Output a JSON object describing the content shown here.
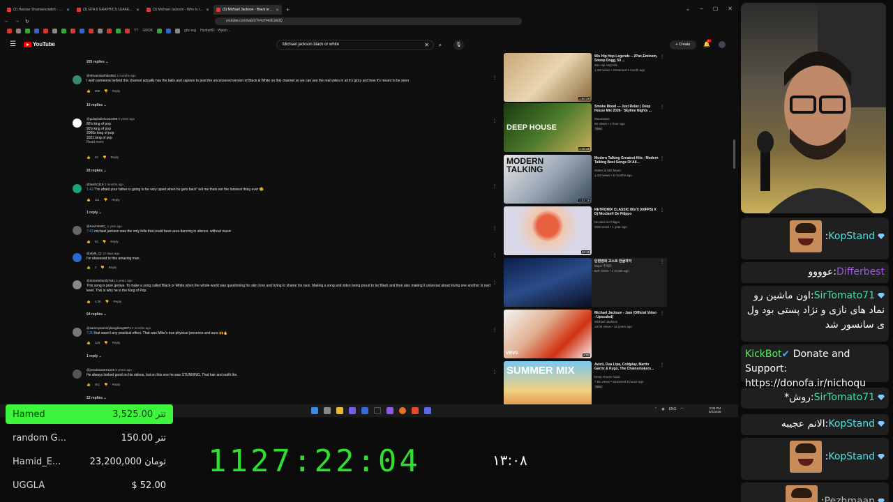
{
  "browser": {
    "tabs": [
      {
        "title": "(3) Hassan Shamaeezadeh - Daro V...",
        "active": false
      },
      {
        "title": "(3) GTA 6 GRAPHICS LEAKED GAME...",
        "active": false
      },
      {
        "title": "(3) Michael Jackson - Who Is It (Offic...",
        "active": false
      },
      {
        "title": "(3) Michael Jackson - Black or Wh...",
        "active": true
      }
    ],
    "new_tab": "+",
    "url": "youtube.com/watch?v=pTFE8cirkdQ",
    "bookmarks": [
      "YT",
      "GROK",
      "gbc-reg",
      "HydraHD - Watch..."
    ]
  },
  "youtube": {
    "logo": "YouTube",
    "search_value": "Michael jackson black or white",
    "create_label": "Create",
    "notif_count": "9+"
  },
  "comments": [
    {
      "type": "replies",
      "label": "205 replies"
    },
    {
      "type": "comment",
      "user": "@shivamkarthik2882",
      "time": "2 months ago",
      "text": "I wish someone behind this channel actually has the balls and cajones to post the uncensored version of Black & White on this channel so we can see the real video in all it's glory and how it's meant to be seen",
      "likes": "398",
      "reply": "Reply"
    },
    {
      "type": "replies",
      "label": "10 replies"
    },
    {
      "type": "comment",
      "user": "@gulaybalishova4399",
      "time": "5 years ago",
      "text_lines": [
        "80's king of pop",
        "90's king of pop",
        "2000s king of pop",
        "2021 king of pop"
      ],
      "more": "Read more",
      "likes": "1K",
      "reply": "Reply"
    },
    {
      "type": "replies",
      "label": "28 replies"
    },
    {
      "type": "comment",
      "user": "@lasith1116",
      "time": "2 months ago",
      "ts": "1:43",
      "text": "\"I'm afraid your father is going to be very upset when he gets back\" tell me thats not the funniest thing ever 😂",
      "likes": "111",
      "reply": "Reply"
    },
    {
      "type": "replies",
      "label": "1 reply"
    },
    {
      "type": "comment",
      "user": "@Kevin5500_",
      "time": "1 year ago",
      "ts": "7:43",
      "text": "michael jackson was the only fella that could have aura dancing in silence, without music",
      "likes": "93",
      "reply": "Reply"
    },
    {
      "type": "comment",
      "user": "@afalk_12",
      "time": "12 days ago",
      "text": "I'm obsessed to this amazing man.",
      "likes": "3",
      "reply": "Reply"
    },
    {
      "type": "comment",
      "user": "@dolcetefamily7541",
      "time": "5 years ago",
      "text": "This song is pure genius. To make a song called Black or White when the whole world was questioning his skin tone and trying to shame his race. Making a song and video being proud to be Black and then also making it universal about loving one another is next level. This is why he is the King of Pop.",
      "likes": "4.3K",
      "reply": "Reply"
    },
    {
      "type": "replies",
      "label": "64 replies"
    },
    {
      "type": "comment",
      "user": "@sammysammybangbang6971",
      "time": "2 months ago",
      "ts": "7:30",
      "text": "that wasn't any practical effect. That was Mike's true physical presence and aura 🙌🔥",
      "likes": "129",
      "reply": "Reply"
    },
    {
      "type": "replies",
      "label": "1 reply"
    },
    {
      "type": "comment",
      "user": "@josedesastre1225",
      "time": "9 years ago",
      "text": "He always looked good on his videos, but on this one he was STUNNING. That hair and outfit tho.",
      "likes": "461",
      "reply": "Reply"
    },
    {
      "type": "replies",
      "label": "22 replies"
    }
  ],
  "sidebar": [
    {
      "title": "90s Hip Hop Legends – 2Pac,Eminem, Snoop Dogg, 50 ...",
      "channel": "90s Hip Hop Mix",
      "stats": "1.1M views • Streamed 1 month ago",
      "duration": "1:00:28"
    },
    {
      "title": "Smoke Mood — Just Relax | Deep House Mix 2026 · Skyline Nights ...",
      "channel": "Moonwave",
      "stats": "5K views • 1 hour ago",
      "badge": "New",
      "duration": "1:15:28"
    },
    {
      "title": "Modern Talking Greatest Hits - Modern Talking Best Songs Of All...",
      "channel": "Oldies & 80s Music",
      "stats": "1.1M views • 5 months ago",
      "duration": "1:22:15"
    },
    {
      "title": "RETROMIX CLASSIC 80s'X (60FPS) X Dj Nicolas® De Filippo",
      "channel": "Nicolas De Filippo",
      "stats": "26M views • 1 year ago",
      "duration": "42:18"
    },
    {
      "title": "단편영화 고스트 한글자막",
      "channel": "Mujer 주재조",
      "stats": "82K views • 1 month ago",
      "duration": ""
    },
    {
      "title": "Michael Jackson - Jam (Official Video - Upscaled)",
      "channel": "Michael Jackson",
      "stats": "107M views • 16 years ago",
      "duration": "8:00"
    },
    {
      "title": "Avicii, Dua Lipa, Coldplay, Martin Garrix & Kygo, The Chainsmokers...",
      "channel": "Deep House Aqua",
      "stats": "7.5K views • Streamed 8 hours ago",
      "badge": "New",
      "duration": ""
    }
  ],
  "thumb_text": {
    "deep_house": "DEEP HOUSE",
    "modern_talking": "MODERN TALKING",
    "summer_mix": "SUMMER MIX",
    "vevo": "vevo"
  },
  "tray": {
    "lang": "ENG",
    "time": "3:08 PM",
    "date": "6/2/2026"
  },
  "donations": [
    {
      "name": "Hamed",
      "amount": "3,525.00 تتر",
      "top": true
    },
    {
      "name": "random G...",
      "amount": "150.00 تتر"
    },
    {
      "name": "Hamid_E...",
      "amount": "23,200,000 تومان"
    },
    {
      "name": "UGGLA",
      "amount": "$ 52.00"
    }
  ],
  "timer": "1127:22:04",
  "clock_fa": "۱۳:۰۸",
  "chat": [
    {
      "user": "KopStand",
      "color": "#4fe0e8",
      "text": "",
      "emote": true
    },
    {
      "user": "Differbest",
      "color": "#9b57e8",
      "text": "عوووو"
    },
    {
      "user": "SirTomato71",
      "color": "#3de0b0",
      "text": "اون ماشین رو نماد های نازی و نژاد پستی بود ول ی سانسور شد"
    },
    {
      "user": "KickBot",
      "color": "#5bf05b",
      "text": "Donate and Support: https://donofa.ir/nichoqu"
    },
    {
      "user": "SirTomato71",
      "color": "#3de0b0",
      "text": "روش*"
    },
    {
      "user": "KopStand",
      "color": "#4fe0e8",
      "text": "الانم عجیبه"
    },
    {
      "user": "KopStand",
      "color": "#4fe0e8",
      "text": "",
      "emote": true
    },
    {
      "user": "Pezhmaan",
      "color": "#b9b9b9",
      "text": "",
      "emote": true
    }
  ]
}
